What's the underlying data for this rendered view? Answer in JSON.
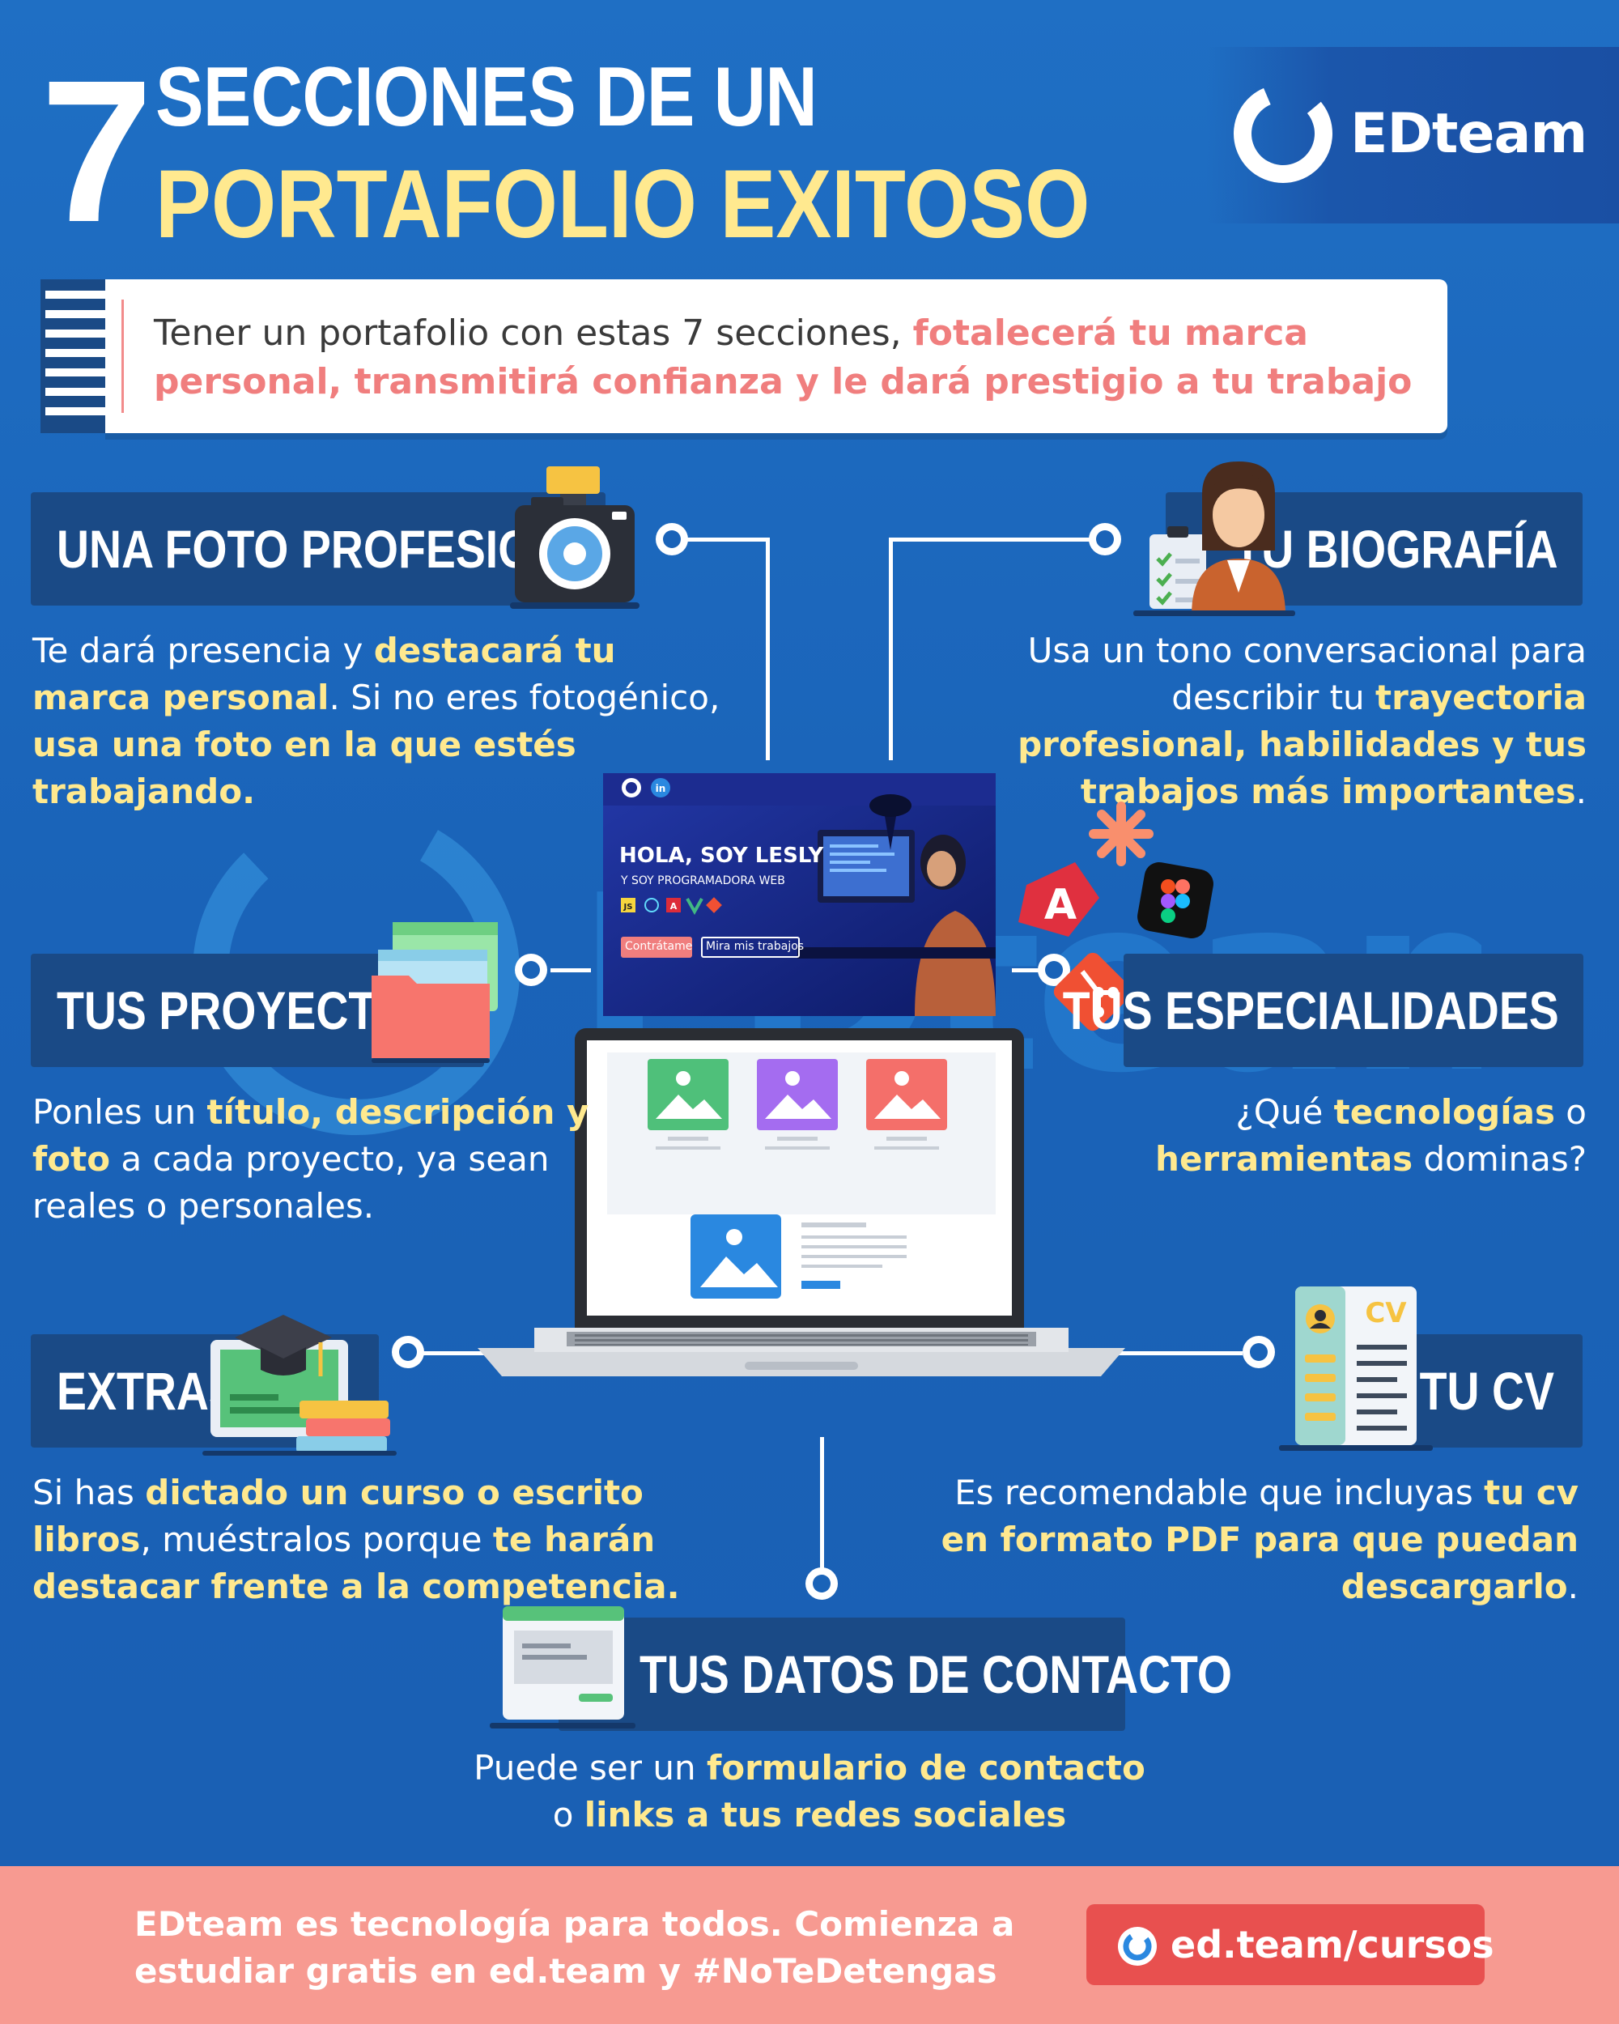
{
  "header": {
    "number": "7",
    "title_line1": "SECCIONES DE UN",
    "title_line2": "PORTAFOLIO EXITOSO",
    "brand": "EDteam"
  },
  "intro": {
    "text_plain": "Tener un portafolio con estas 7 secciones, ",
    "text_highlight": "fotalecerá tu marca personal, transmitirá confianza y le dará prestigio a tu trabajo"
  },
  "sections": {
    "photo": {
      "title": "UNA FOTO PROFESIONAL",
      "d1": "Te dará presencia y ",
      "d2": "destacará tu marca personal",
      "d3": ". Si no eres fotogénico, ",
      "d4": "usa una foto en la que estés trabajando."
    },
    "bio": {
      "title": "TU BIOGRAFÍA",
      "d1": "Usa un tono conversacional para describir tu ",
      "d2": "trayectoria profesional, habilidades y tus trabajos más importantes",
      "d3": "."
    },
    "projects": {
      "title": "TUS PROYECTOS",
      "d1": "Ponles un ",
      "d2": "título, descripción y foto",
      "d3": " a cada proyecto, ya sean reales o personales."
    },
    "skills": {
      "title": "TUS ESPECIALIDADES",
      "d1": "¿Qué ",
      "d2": "tecnologías",
      "d3": " o ",
      "d4": "herramientas",
      "d5": " dominas?"
    },
    "extras": {
      "title": "EXTRAS",
      "d1": "Si has ",
      "d2": "dictado un curso o escrito libros",
      "d3": ", muéstralos porque ",
      "d4": "te harán destacar frente a la competencia."
    },
    "cv": {
      "title": "TU CV",
      "cv_icon_label": "CV",
      "d1": "Es recomendable que incluyas ",
      "d2": "tu cv en formato PDF para que puedan descargarlo",
      "d3": "."
    },
    "contact": {
      "title": "TUS DATOS DE CONTACTO",
      "d1": "Puede ser un ",
      "d2": "formulario de contacto",
      "d3": " o ",
      "d4": "links a tus redes sociales"
    }
  },
  "laptop": {
    "hero_title": "HOLA, SOY LESLY",
    "hero_subtitle": "Y SOY PROGRAMADORA WEB",
    "btn_primary": "Contrátame",
    "btn_secondary": "Mira mis trabajos",
    "social_icons": [
      "github-icon",
      "linkedin-icon"
    ],
    "tech_badges": [
      "JS",
      "A"
    ]
  },
  "footer": {
    "text": "EDteam es tecnología para todos. Comienza a estudiar gratis en ed.team y #NoTeDetengas",
    "button_label": "ed.team/cursos"
  },
  "colors": {
    "background": "#1a63b8",
    "section_box": "#1a4a86",
    "highlight_yellow": "#ffe98f",
    "highlight_coral": "#f07e7e",
    "footer": "#f79a91",
    "footer_button": "#e8504f"
  }
}
